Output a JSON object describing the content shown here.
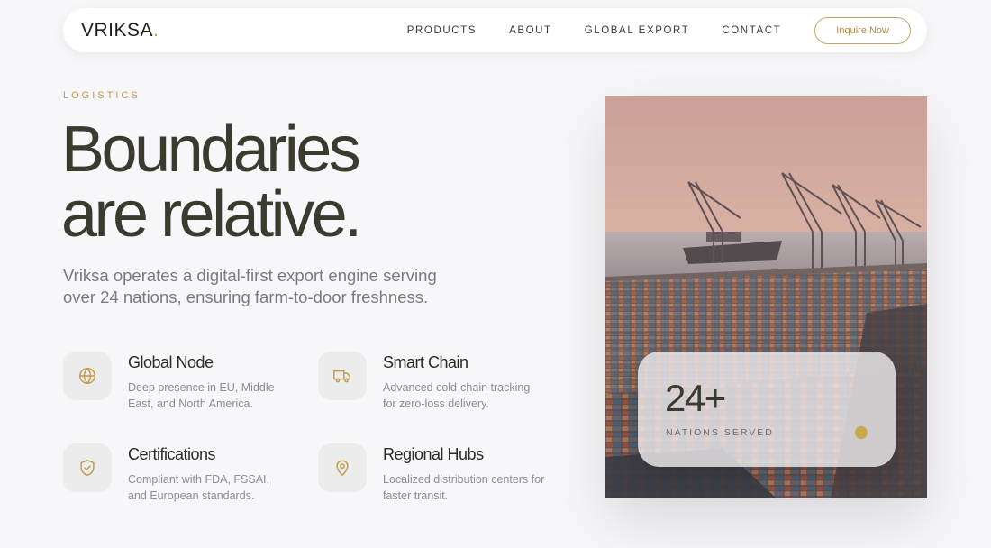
{
  "nav": {
    "logo_text": "VRIKSA",
    "logo_dot": ".",
    "links": [
      "PRODUCTS",
      "ABOUT",
      "GLOBAL EXPORT",
      "CONTACT"
    ],
    "cta_label": "Inquire Now"
  },
  "hero": {
    "eyebrow": "LOGISTICS",
    "headline_line1": "Boundaries",
    "headline_line2": "are relative.",
    "lede": "Vriksa operates a digital-first export engine serving over 24 nations, ensuring farm-to-door freshness."
  },
  "features": [
    {
      "icon": "globe-icon",
      "title": "Global Node",
      "desc": "Deep presence in EU, Middle East, and North America."
    },
    {
      "icon": "truck-icon",
      "title": "Smart Chain",
      "desc": "Advanced cold-chain tracking for zero-loss delivery."
    },
    {
      "icon": "shield-check-icon",
      "title": "Certifications",
      "desc": "Compliant with FDA, FSSAI, and European standards."
    },
    {
      "icon": "map-pin-icon",
      "title": "Regional Hubs",
      "desc": "Localized distribution centers for faster transit."
    }
  ],
  "stat": {
    "value": "24+",
    "label": "NATIONS SERVED"
  },
  "colors": {
    "accent": "#c19a4b",
    "background": "#f7f6f8",
    "text": "#3a3a2e"
  }
}
